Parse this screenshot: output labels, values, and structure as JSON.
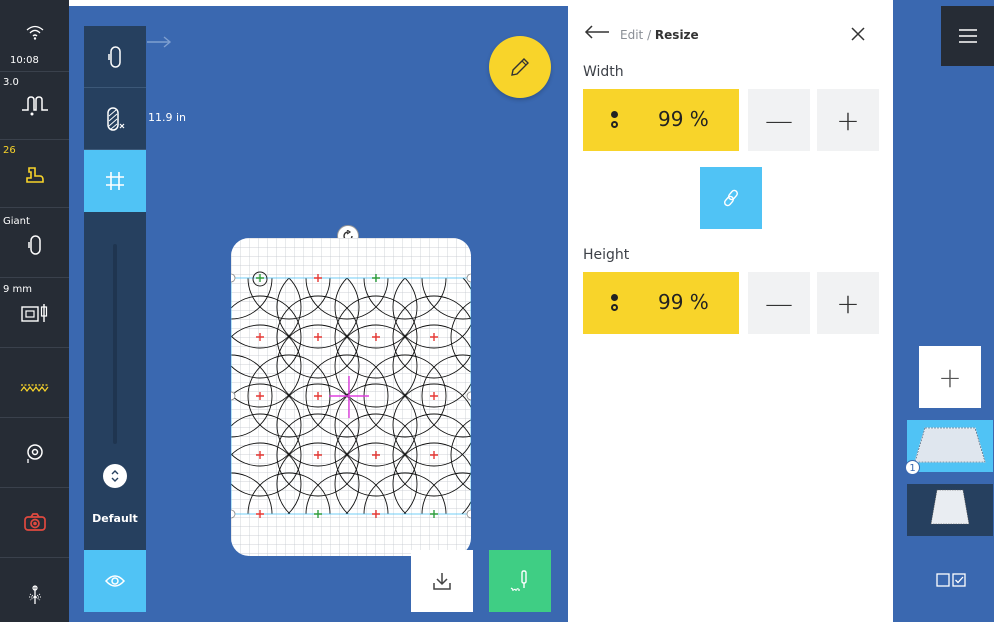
{
  "status_bar": {
    "time": "10:08",
    "wifi_icon": "wifi-icon",
    "stitch_length": "3.0",
    "stitch_icon": "stitch-length-icon",
    "tension": "26",
    "tension_icon": "presser-foot-icon",
    "hoop_label": "Giant",
    "hoop_icon": "hoop-icon",
    "needle_label": "9 mm",
    "needle_icon": "needle-plate-icon",
    "colors": {
      "tension": "#f8d42a",
      "accent": "#50c3f5",
      "dark": "#262c35"
    }
  },
  "canvas": {
    "size_label": "11.9 in",
    "tool_dock_label": "Default"
  },
  "edit_panel": {
    "breadcrumb_parent": "Edit",
    "breadcrumb_sep": " / ",
    "breadcrumb_current": "Resize",
    "width_label": "Width",
    "width_value": "99 %",
    "height_label": "Height",
    "height_value": "99 %",
    "minus_label": "—",
    "plus_label": "+"
  },
  "sidebar": {
    "add_label": "+",
    "design_count": "1"
  }
}
